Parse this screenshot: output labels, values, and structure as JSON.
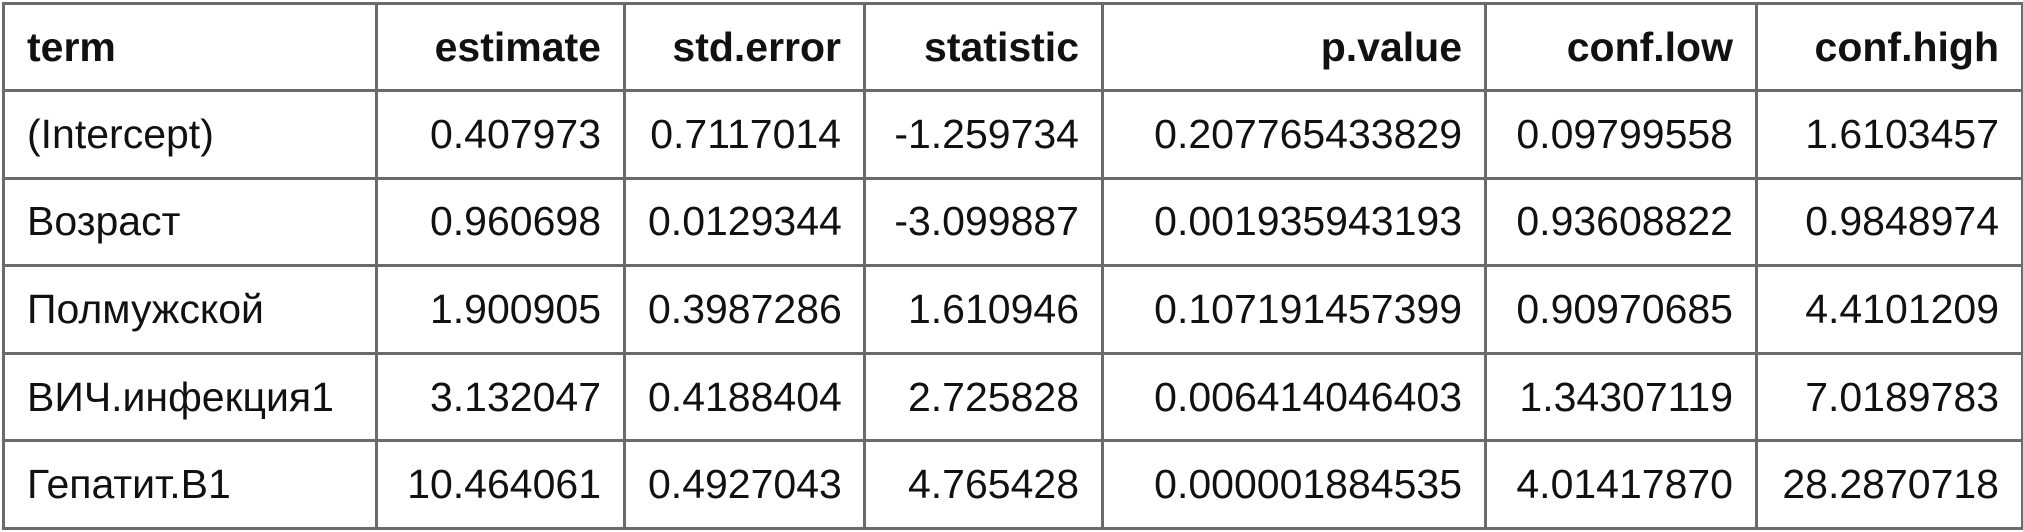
{
  "table": {
    "columns": [
      "term",
      "estimate",
      "std.error",
      "statistic",
      "p.value",
      "conf.low",
      "conf.high"
    ],
    "rows": [
      [
        "(Intercept)",
        "0.407973",
        "0.7117014",
        "-1.259734",
        "0.207765433829",
        "0.09799558",
        "1.6103457"
      ],
      [
        "Возраст",
        "0.960698",
        "0.0129344",
        "-3.099887",
        "0.001935943193",
        "0.93608822",
        "0.9848974"
      ],
      [
        "Полмужской",
        "1.900905",
        "0.3987286",
        "1.610946",
        "0.107191457399",
        "0.90970685",
        "4.4101209"
      ],
      [
        "ВИЧ.инфекция1",
        "3.132047",
        "0.4188404",
        "2.725828",
        "0.006414046403",
        "1.34307119",
        "7.0189783"
      ],
      [
        "Гепатит.B1",
        "10.464061",
        "0.4927043",
        "4.765428",
        "0.000001884535",
        "4.01417870",
        "28.2870718"
      ]
    ]
  }
}
